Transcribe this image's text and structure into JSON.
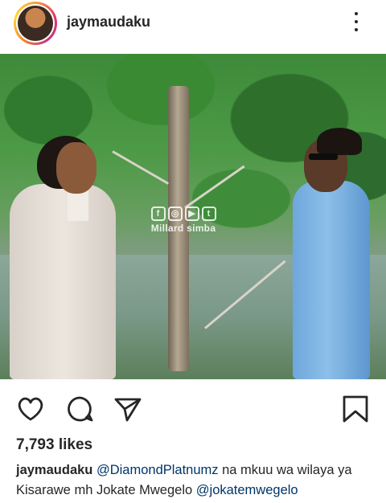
{
  "post": {
    "username": "jaymaudaku",
    "likes": "7,793 likes",
    "watermark": "Millard simba",
    "watermark_icons": [
      "f",
      "◎",
      "▶",
      "t"
    ],
    "caption": {
      "user": "jaymaudaku",
      "mention1": "@DiamondPlatnumz",
      "text1": "na mkuu wa wilaya ya Kisarawe mh Jokate Mwegelo",
      "mention2": "@jokatemwegelo"
    }
  },
  "icons": {
    "more": "more-vertical-icon",
    "like": "heart-icon",
    "comment": "comment-bubble-icon",
    "share": "paper-plane-icon",
    "save": "bookmark-icon"
  },
  "colors": {
    "text": "#262626",
    "mention": "#003569",
    "story_ring": "#e1306c"
  }
}
